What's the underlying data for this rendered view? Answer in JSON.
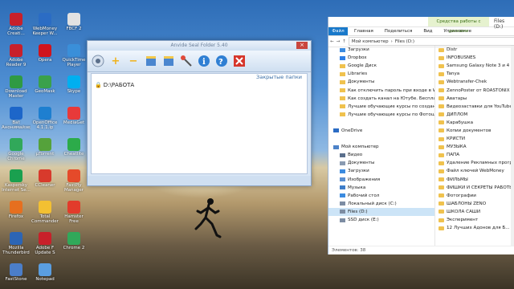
{
  "desktop": {
    "icons": [
      {
        "label": "Adobe Creati...",
        "color": "#c8202a"
      },
      {
        "label": "WebMoney Keeper W...",
        "color": "#2b6cc4"
      },
      {
        "label": "FBCF 2",
        "color": "#e2e2e2"
      },
      {
        "label": "Adobe Reader 9",
        "color": "#c8202a"
      },
      {
        "label": "Opera",
        "color": "#d0141d"
      },
      {
        "label": "QuickTime Player",
        "color": "#3a8fd9"
      },
      {
        "label": "Download Master",
        "color": "#2f9a43"
      },
      {
        "label": "GeoMask",
        "color": "#3aa14b"
      },
      {
        "label": "Skype",
        "color": "#00aff0"
      },
      {
        "label": "Bat Анонимайзер",
        "color": "#1d66c9"
      },
      {
        "label": "OpenOffice 4.1.1.ip",
        "color": "#1e7fd0"
      },
      {
        "label": "MediaGet",
        "color": "#e83a3a"
      },
      {
        "label": "Google Chrome",
        "color": "#31a85a"
      },
      {
        "label": "µTorrent",
        "color": "#55a23b"
      },
      {
        "label": "Cheatlite",
        "color": "#2cab4a"
      },
      {
        "label": "Kaspersky Internet Se...",
        "color": "#1aa04f"
      },
      {
        "label": "CCleaner",
        "color": "#d83a2c"
      },
      {
        "label": "FastPly Manager",
        "color": "#e54a2a"
      },
      {
        "label": "Firefox",
        "color": "#e66f1f"
      },
      {
        "label": "Total Commander",
        "color": "#f3c032"
      },
      {
        "label": "Hamster Free",
        "color": "#e23b2b"
      },
      {
        "label": "Mozilla Thunderbird",
        "color": "#2c65b5"
      },
      {
        "label": "Adobe F Update S",
        "color": "#c8202a"
      },
      {
        "label": "Chrome 2",
        "color": "#31a85a"
      },
      {
        "label": "FastStone",
        "color": "#4b7ec9"
      },
      {
        "label": "Notepad",
        "color": "#5a9ee0"
      }
    ]
  },
  "anvide": {
    "title": "Anvide Seal Folder 5.40",
    "hidden_label": "Закрытые папки",
    "folder": "D:\\РАБОТА",
    "toolbar": [
      "add",
      "remove",
      "lock",
      "unlock",
      "key",
      "info",
      "help",
      "close"
    ]
  },
  "explorer": {
    "title": "Files (D:)",
    "context_tab": "Средства работы с дисками",
    "ribbon": {
      "file": "Файл",
      "tabs": [
        "Главная",
        "Поделиться",
        "Вид",
        "Управление"
      ]
    },
    "address": {
      "path1": "Мой компьютер",
      "path2": "Files (D:)"
    },
    "nav_items": [
      {
        "label": "Загрузки",
        "type": "download"
      },
      {
        "label": "Dropbox",
        "type": "dropbox"
      },
      {
        "label": "Google Диск",
        "type": "folder"
      },
      {
        "label": "Libraries",
        "type": "folder"
      },
      {
        "label": "Документы",
        "type": "folder"
      },
      {
        "label": "Как отключить пароль при входе в Win",
        "type": "folder"
      },
      {
        "label": "Как создать канал на Ютубе. Бесплатна",
        "type": "folder"
      },
      {
        "label": "Лучшие обучающие курсы по создани",
        "type": "folder"
      },
      {
        "label": "Лучшие обучающие курсы по Фотошо",
        "type": "folder"
      },
      {
        "label": "",
        "type": "blank"
      },
      {
        "label": "OneDrive",
        "type": "cloud"
      },
      {
        "label": "",
        "type": "blank"
      },
      {
        "label": "Мой компьютер",
        "type": "pc"
      },
      {
        "label": "Видео",
        "type": "video"
      },
      {
        "label": "Документы",
        "type": "doc"
      },
      {
        "label": "Загрузки",
        "type": "download"
      },
      {
        "label": "Изображения",
        "type": "image"
      },
      {
        "label": "Музыка",
        "type": "music"
      },
      {
        "label": "Рабочий стол",
        "type": "desktop"
      },
      {
        "label": "Локальный диск (C:)",
        "type": "drive"
      },
      {
        "label": "Files (D:)",
        "type": "drive",
        "selected": true
      },
      {
        "label": "SSD диск (E:)",
        "type": "drive"
      }
    ],
    "list_items": [
      "Distr",
      "INFOBUSNES",
      "Samsung Galaxy Note 3 и 4",
      "Tanya",
      "Webtransfer-Chek",
      "ZennoPoster от ROASTONIX",
      "Аватары",
      "Видеозаставки для YouTube",
      "ДИПЛОМ",
      "Карабушка",
      "Копии документов",
      "КРИСТИ",
      "МУЗЫКА",
      "ПАПА",
      "Удаление Рекламных программ",
      "Файл ключей WebMoney",
      "ФИЛЬМЫ",
      "ФИШКИ И СЕКРЕТЫ РАБОТЫ НА",
      "Фотографии",
      "ШАБЛОНЫ ZENO",
      "ШКОЛА САШИ",
      "Эксперимент",
      "12 Лучших Адонов для Б..."
    ],
    "status": "Элементов: 38"
  }
}
